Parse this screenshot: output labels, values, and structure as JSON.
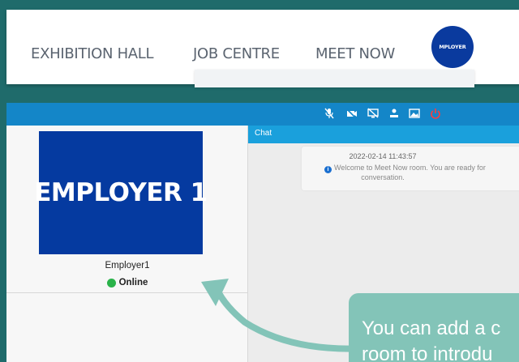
{
  "nav": {
    "items": [
      {
        "label": "EXHIBITION HALL"
      },
      {
        "label": "JOB CENTRE"
      },
      {
        "label": "MEET NOW"
      }
    ],
    "logo_text": "MPLOYER"
  },
  "toolbar": {
    "icons": [
      "mic-off-icon",
      "video-off-icon",
      "screen-share-off-icon",
      "user-icon",
      "image-icon",
      "power-icon"
    ],
    "power_color": "#ff3b3b"
  },
  "employer": {
    "banner_text": "EMPLOYER 1",
    "name": "Employer1",
    "status": "Online",
    "status_color": "#2ab34a"
  },
  "chat": {
    "header": "Chat",
    "message": {
      "timestamp": "2022-02-14 11:43:57",
      "text": "Welcome to Meet Now room. You are ready for",
      "text_line2": "conversation."
    }
  },
  "overlay": {
    "tooltip_line1": "You can add a c",
    "tooltip_line2": "room to introdu",
    "accent_color": "#83c4b8"
  }
}
